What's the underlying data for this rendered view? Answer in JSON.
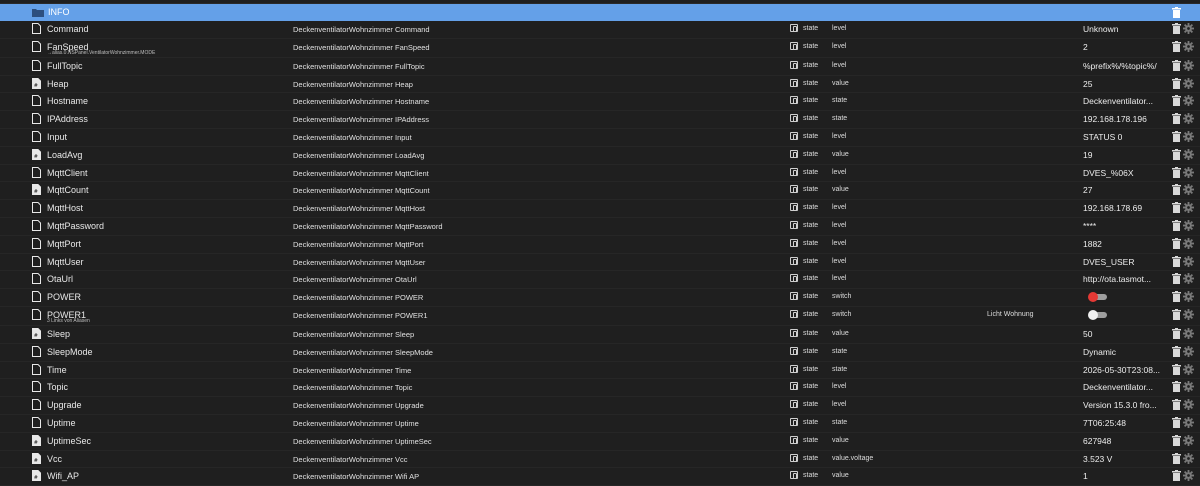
{
  "folder": {
    "label": "INFO"
  },
  "rows": [
    {
      "name": "Command",
      "alias": "",
      "desc": "DeckenventilatorWohnzimmer Command",
      "type": "state",
      "role": "level",
      "room": "",
      "value": "Unknown",
      "kind": "text"
    },
    {
      "name": "FanSpeed",
      "alias": "→alias.0.NSPanel.VentilatorWohnzimmer.MODE",
      "desc": "DeckenventilatorWohnzimmer FanSpeed",
      "type": "state",
      "role": "level",
      "room": "",
      "value": "2",
      "kind": "text"
    },
    {
      "name": "FullTopic",
      "alias": "",
      "desc": "DeckenventilatorWohnzimmer FullTopic",
      "type": "state",
      "role": "level",
      "room": "",
      "value": "%prefix%/%topic%/",
      "kind": "text"
    },
    {
      "name": "Heap",
      "alias": "",
      "desc": "DeckenventilatorWohnzimmer Heap",
      "type": "state",
      "role": "value",
      "room": "",
      "value": "25",
      "kind": "num"
    },
    {
      "name": "Hostname",
      "alias": "",
      "desc": "DeckenventilatorWohnzimmer Hostname",
      "type": "state",
      "role": "state",
      "room": "",
      "value": "Deckenventilator...",
      "kind": "text"
    },
    {
      "name": "IPAddress",
      "alias": "",
      "desc": "DeckenventilatorWohnzimmer IPAddress",
      "type": "state",
      "role": "state",
      "room": "",
      "value": "192.168.178.196",
      "kind": "text"
    },
    {
      "name": "Input",
      "alias": "",
      "desc": "DeckenventilatorWohnzimmer Input",
      "type": "state",
      "role": "level",
      "room": "",
      "value": "STATUS 0",
      "kind": "text"
    },
    {
      "name": "LoadAvg",
      "alias": "",
      "desc": "DeckenventilatorWohnzimmer LoadAvg",
      "type": "state",
      "role": "value",
      "room": "",
      "value": "19",
      "kind": "num"
    },
    {
      "name": "MqttClient",
      "alias": "",
      "desc": "DeckenventilatorWohnzimmer MqttClient",
      "type": "state",
      "role": "level",
      "room": "",
      "value": "DVES_%06X",
      "kind": "text"
    },
    {
      "name": "MqttCount",
      "alias": "",
      "desc": "DeckenventilatorWohnzimmer MqttCount",
      "type": "state",
      "role": "value",
      "room": "",
      "value": "27",
      "kind": "num"
    },
    {
      "name": "MqttHost",
      "alias": "",
      "desc": "DeckenventilatorWohnzimmer MqttHost",
      "type": "state",
      "role": "level",
      "room": "",
      "value": "192.168.178.69",
      "kind": "text"
    },
    {
      "name": "MqttPassword",
      "alias": "",
      "desc": "DeckenventilatorWohnzimmer MqttPassword",
      "type": "state",
      "role": "level",
      "room": "",
      "value": "****",
      "kind": "text"
    },
    {
      "name": "MqttPort",
      "alias": "",
      "desc": "DeckenventilatorWohnzimmer MqttPort",
      "type": "state",
      "role": "level",
      "room": "",
      "value": "1882",
      "kind": "text"
    },
    {
      "name": "MqttUser",
      "alias": "",
      "desc": "DeckenventilatorWohnzimmer MqttUser",
      "type": "state",
      "role": "level",
      "room": "",
      "value": "DVES_USER",
      "kind": "text"
    },
    {
      "name": "OtaUrl",
      "alias": "",
      "desc": "DeckenventilatorWohnzimmer OtaUrl",
      "type": "state",
      "role": "level",
      "room": "",
      "value": "http://ota.tasmot...",
      "kind": "text"
    },
    {
      "name": "POWER",
      "alias": "",
      "desc": "DeckenventilatorWohnzimmer POWER",
      "type": "state",
      "role": "switch",
      "room": "",
      "value": "",
      "kind": "toggle-on"
    },
    {
      "name": "POWER1",
      "alias": "3 Links von Aliasen",
      "desc": "DeckenventilatorWohnzimmer POWER1",
      "type": "state",
      "role": "switch",
      "room": "Licht Wohnung",
      "value": "",
      "kind": "toggle-off"
    },
    {
      "name": "Sleep",
      "alias": "",
      "desc": "DeckenventilatorWohnzimmer Sleep",
      "type": "state",
      "role": "value",
      "room": "",
      "value": "50",
      "kind": "num"
    },
    {
      "name": "SleepMode",
      "alias": "",
      "desc": "DeckenventilatorWohnzimmer SleepMode",
      "type": "state",
      "role": "state",
      "room": "",
      "value": "Dynamic",
      "kind": "text"
    },
    {
      "name": "Time",
      "alias": "",
      "desc": "DeckenventilatorWohnzimmer Time",
      "type": "state",
      "role": "state",
      "room": "",
      "value": "2026-05-30T23:08...",
      "kind": "text"
    },
    {
      "name": "Topic",
      "alias": "",
      "desc": "DeckenventilatorWohnzimmer Topic",
      "type": "state",
      "role": "level",
      "room": "",
      "value": "Deckenventilator...",
      "kind": "text"
    },
    {
      "name": "Upgrade",
      "alias": "",
      "desc": "DeckenventilatorWohnzimmer Upgrade",
      "type": "state",
      "role": "level",
      "room": "",
      "value": "Version 15.3.0 fro...",
      "kind": "text"
    },
    {
      "name": "Uptime",
      "alias": "",
      "desc": "DeckenventilatorWohnzimmer Uptime",
      "type": "state",
      "role": "state",
      "room": "",
      "value": "7T06:25:48",
      "kind": "text"
    },
    {
      "name": "UptimeSec",
      "alias": "",
      "desc": "DeckenventilatorWohnzimmer UptimeSec",
      "type": "state",
      "role": "value",
      "room": "",
      "value": "627948",
      "kind": "num"
    },
    {
      "name": "Vcc",
      "alias": "",
      "desc": "DeckenventilatorWohnzimmer Vcc",
      "type": "state",
      "role": "value.voltage",
      "room": "",
      "value": "3.523 V",
      "kind": "num"
    },
    {
      "name": "Wifi_AP",
      "alias": "",
      "desc": "DeckenventilatorWohnzimmer Wifi AP",
      "type": "state",
      "role": "value",
      "room": "",
      "value": "1",
      "kind": "num"
    }
  ],
  "colors": {
    "header": "#64a0e8",
    "background": "#1f1f1f",
    "toggle_on": "#e53935"
  }
}
